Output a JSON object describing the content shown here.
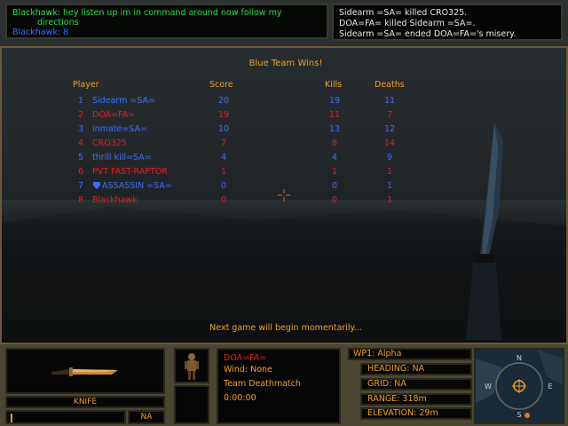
{
  "chat": {
    "line1": "Blackhawk: hey listen up im in command around now follow my",
    "line2": "directions",
    "line3": "Blackhawk: 8"
  },
  "killfeed": [
    "Sidearm =SA= killed CRO325.",
    "DOA=FA= killed Sidearm =SA=.",
    "Sidearm =SA= ended DOA=FA='s misery."
  ],
  "scoreboard": {
    "title": "Blue Team Wins!",
    "headers": {
      "player": "Player",
      "score": "Score",
      "kills": "Kills",
      "deaths": "Deaths"
    },
    "rows": [
      {
        "num": "1",
        "name": "Sidearm =SA=",
        "score": "20",
        "kills": "19",
        "deaths": "11",
        "team": "blue"
      },
      {
        "num": "2",
        "name": "DOA=FA=",
        "score": "19",
        "kills": "11",
        "deaths": "7",
        "team": "red"
      },
      {
        "num": "3",
        "name": "inmate=SA=",
        "score": "10",
        "kills": "13",
        "deaths": "12",
        "team": "blue"
      },
      {
        "num": "4",
        "name": "CRO325",
        "score": "7",
        "kills": "8",
        "deaths": "14",
        "team": "red"
      },
      {
        "num": "5",
        "name": "thrill kill=SA=",
        "score": "4",
        "kills": "4",
        "deaths": "9",
        "team": "blue"
      },
      {
        "num": "6",
        "name": "PVT FAST-RAPTOR",
        "score": "1",
        "kills": "1",
        "deaths": "1",
        "team": "red"
      },
      {
        "num": "7",
        "name": "ASSASSIN =SA=",
        "score": "0",
        "kills": "0",
        "deaths": "1",
        "team": "blue"
      },
      {
        "num": "8",
        "name": "Blackhawk",
        "score": "0",
        "kills": "0",
        "deaths": "1",
        "team": "red"
      }
    ],
    "footer": "Next game will begin momentarily..."
  },
  "hud": {
    "weapon_name": "KNIFE",
    "ammo_value": "NA",
    "player_name": "DOA=FA=",
    "wind": "Wind: None",
    "mode": "Team Deathmatch",
    "timer": "0:00:00",
    "waypoint": "WP1: Alpha",
    "heading": "HEADING: NA",
    "grid": "GRID: NA",
    "range": "RANGE: 318m",
    "elevation": "ELEVATION: 29m",
    "compass": {
      "n": "N",
      "e": "E",
      "s": "S",
      "w": "W"
    }
  },
  "colors": {
    "accent": "#f0a020",
    "blue_team": "#3b6cff",
    "red_team": "#e02020",
    "chat": "#22e046"
  },
  "icons": {
    "weapon": "knife-icon",
    "soldier": "soldier-icon",
    "compass": "compass-icon",
    "crosshair": "crosshair-icon",
    "clan": "shield-icon"
  }
}
